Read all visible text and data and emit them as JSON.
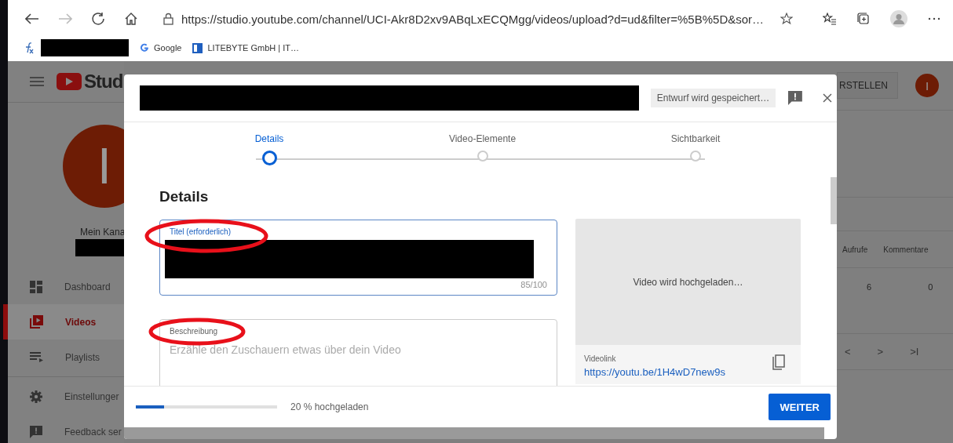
{
  "browser": {
    "url": "https://studio.youtube.com/channel/UCI-Akr8D2xv9ABqLxECQMgg/videos/upload?d=ud&filter=%5B%5D&sor…",
    "bookmarks": [
      {
        "label": "Google",
        "kind": "google"
      },
      {
        "label": "LITEBYTE GmbH | IT…",
        "kind": "site"
      }
    ]
  },
  "studio": {
    "logo_text": "Stud",
    "avatar_letter": "I",
    "channel_label": "Mein Kana",
    "nav": [
      {
        "label": "Dashboard",
        "selected": false,
        "kind": "dashboard"
      },
      {
        "label": "Videos",
        "selected": true,
        "kind": "videos"
      },
      {
        "label": "Playlists",
        "selected": false,
        "kind": "playlists"
      },
      {
        "label": "Einstellunger",
        "selected": false,
        "kind": "settings"
      },
      {
        "label": "Feedback ser",
        "selected": false,
        "kind": "feedback"
      }
    ],
    "create_button": "RSTELLEN",
    "header_avatar": "I",
    "columns": [
      "Aufrufe",
      "Kommentare"
    ],
    "row": [
      "6",
      "0"
    ],
    "pager": [
      "<",
      ">",
      ">I"
    ]
  },
  "dialog": {
    "status": "Entwurf wird gespeichert…",
    "steps": [
      {
        "label": "Details",
        "selected": true
      },
      {
        "label": "Video-Elemente",
        "selected": false
      },
      {
        "label": "Sichtbarkeit",
        "selected": false
      }
    ],
    "heading": "Details",
    "title_field": {
      "label": "Titel (erforderlich)",
      "counter": "85/100"
    },
    "description_field": {
      "label": "Beschreibung",
      "placeholder": "Erzähle den Zuschauern etwas über dein Video"
    },
    "preview": {
      "status": "Video wird hochgeladen…",
      "link_label": "Videolink",
      "link": "https://youtu.be/1H4wD7new9s"
    },
    "upload": {
      "level": 0.2,
      "text": "20 % hochgeladen"
    },
    "next_button": "WEITER"
  }
}
